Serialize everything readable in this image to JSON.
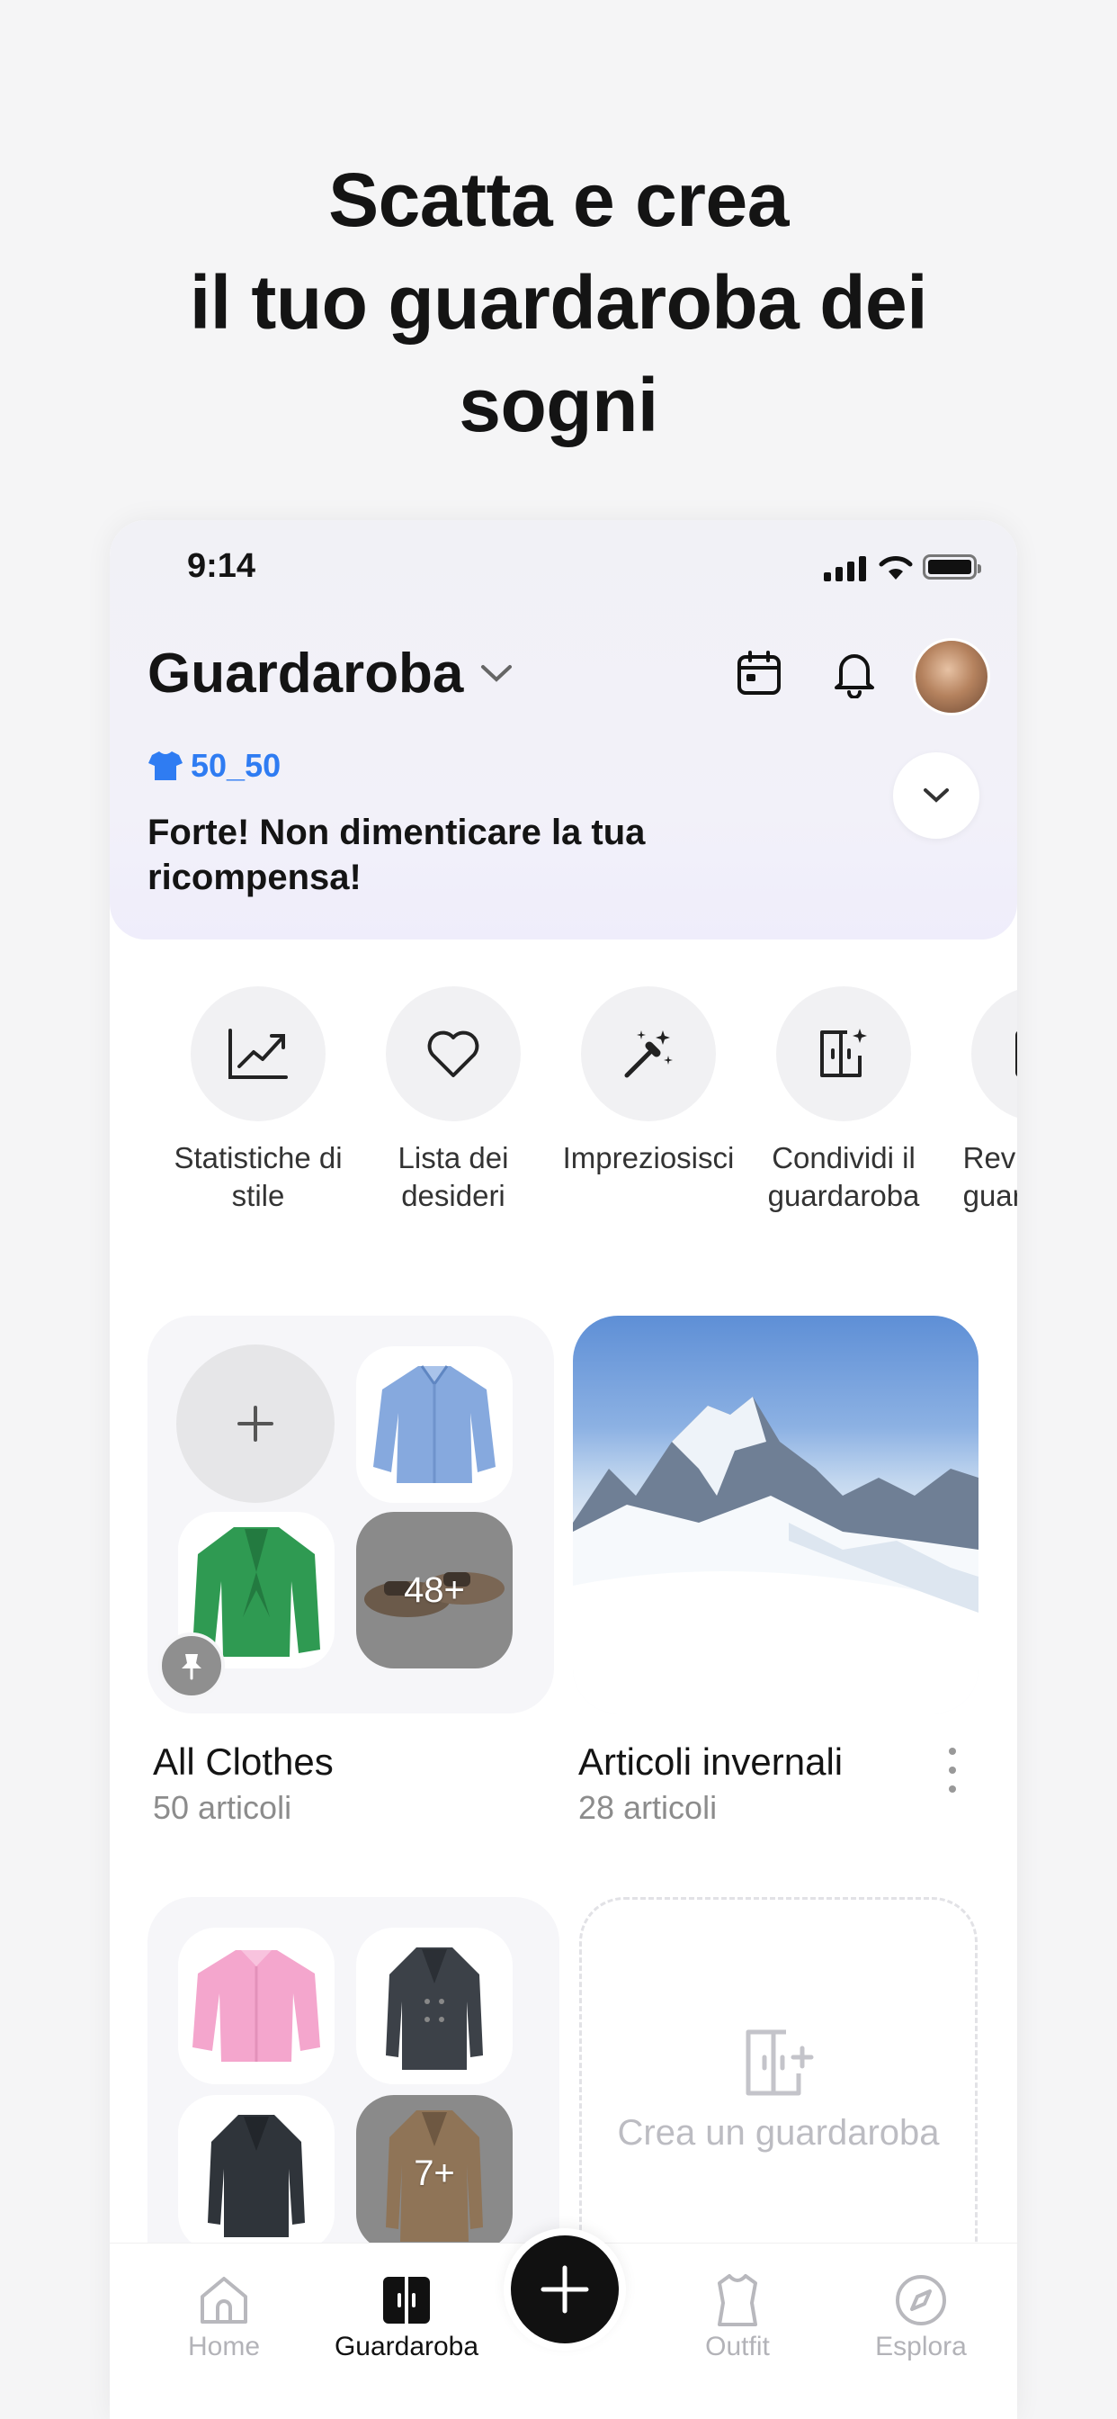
{
  "headline": [
    "Scatta e crea",
    "il tuo guardaroba dei",
    "sogni"
  ],
  "status": {
    "time": "9:14"
  },
  "header": {
    "title": "Guardaroba"
  },
  "badge": {
    "label": "50_50",
    "color": "#2f7cf2"
  },
  "promo": {
    "text": "Forte! Non dimenticare la tua ricompensa!"
  },
  "actions": [
    {
      "label": "Statistiche di stile",
      "icon": "chart-trend-icon"
    },
    {
      "label": "Lista dei desideri",
      "icon": "heart-icon"
    },
    {
      "label": "Impreziosisci",
      "icon": "magic-wand-icon"
    },
    {
      "label": "Condividi il guardaroba",
      "icon": "share-wardrobe-icon"
    },
    {
      "label": "Revisiona il guardaroba",
      "icon": "review-icon"
    }
  ],
  "wardrobes": [
    {
      "title": "All Clothes",
      "count": "50 articoli",
      "more": "48+"
    },
    {
      "title": "Articoli invernali",
      "count": "28 articoli"
    },
    {
      "more": "7+"
    }
  ],
  "create": {
    "label": "Crea un guardaroba"
  },
  "tabs": [
    {
      "label": "Home",
      "icon": "home-icon"
    },
    {
      "label": "Guardaroba",
      "icon": "wardrobe-icon",
      "active": true
    },
    {
      "label": "Outfit",
      "icon": "outfit-icon"
    },
    {
      "label": "Esplora",
      "icon": "compass-icon"
    }
  ]
}
